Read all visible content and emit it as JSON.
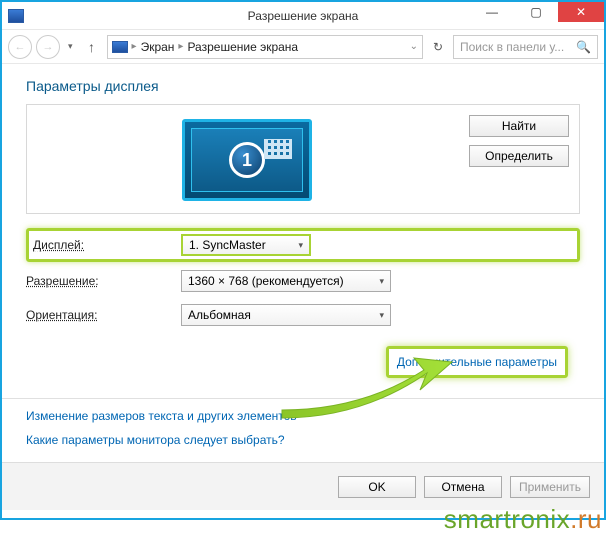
{
  "titlebar": {
    "title": "Разрешение экрана"
  },
  "nav": {
    "crumb1": "Экран",
    "crumb2": "Разрешение экрана",
    "search_placeholder": "Поиск в панели у..."
  },
  "page": {
    "heading": "Параметры дисплея"
  },
  "preview": {
    "monitor_number": "1",
    "btn_find": "Найти",
    "btn_detect": "Определить"
  },
  "form": {
    "display_label": "Дисплей:",
    "display_value": "1. SyncMaster",
    "resolution_label": "Разрешение:",
    "resolution_value": "1360 × 768 (рекомендуется)",
    "orientation_label": "Ориентация:",
    "orientation_value": "Альбомная"
  },
  "links": {
    "advanced": "Дополнительные параметры",
    "text_size": "Изменение размеров текста и других элементов",
    "which_settings": "Какие параметры монитора следует выбрать?"
  },
  "footer": {
    "ok": "OK",
    "cancel": "Отмена",
    "apply": "Применить"
  },
  "watermark": {
    "part1": "smartronix",
    "part2": ".ru"
  }
}
